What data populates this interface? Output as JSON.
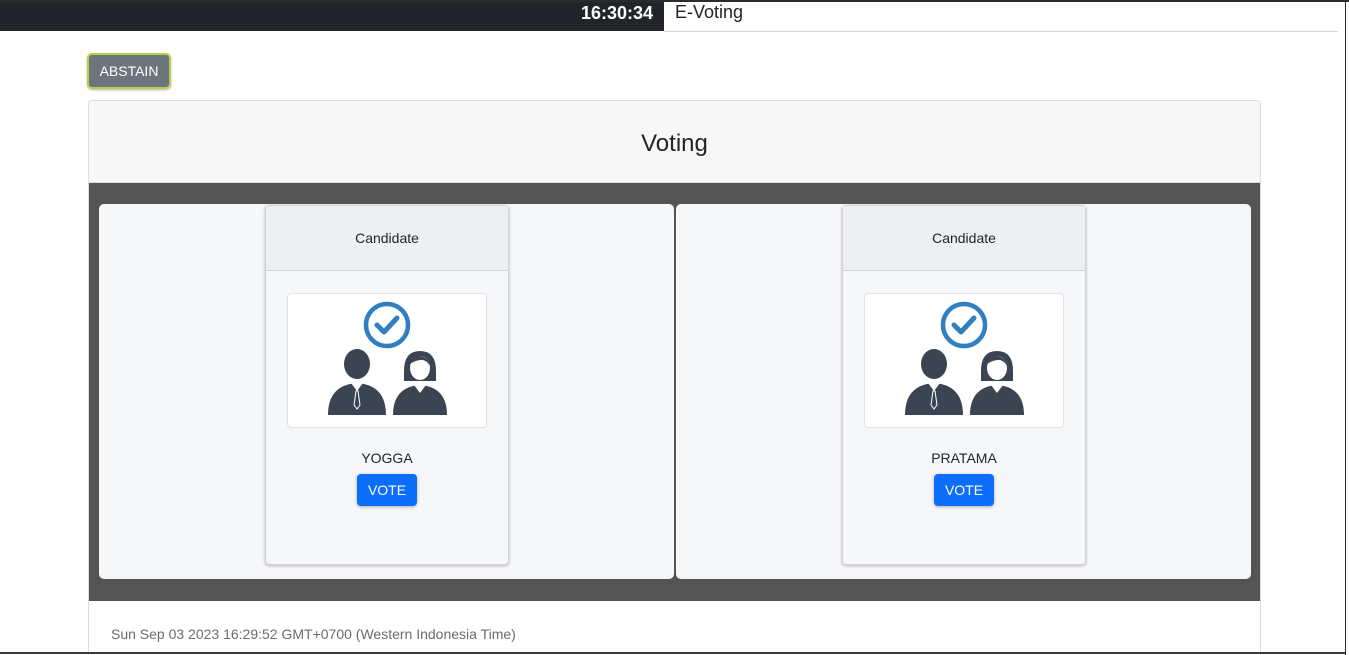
{
  "topbar": {
    "clock": "16:30:34",
    "brand": "E-Voting"
  },
  "abstain": {
    "label": "ABSTAIN"
  },
  "voting": {
    "title": "Voting",
    "candidates": [
      {
        "header": "Candidate",
        "name": "YOGGA",
        "vote_label": "VOTE",
        "image_icon": "candidates-check-icon"
      },
      {
        "header": "Candidate",
        "name": "PRATAMA",
        "vote_label": "VOTE",
        "image_icon": "candidates-check-icon"
      }
    ],
    "footer_time": "Sun Sep 03 2023 16:29:52 GMT+0700 (Western Indonesia Time)"
  },
  "colors": {
    "accent_blue": "#0d6efd",
    "icon_blue": "#2f7fc1",
    "icon_dark": "#3a4453",
    "topbar": "#212529",
    "abstain_bg": "#6c757d"
  }
}
